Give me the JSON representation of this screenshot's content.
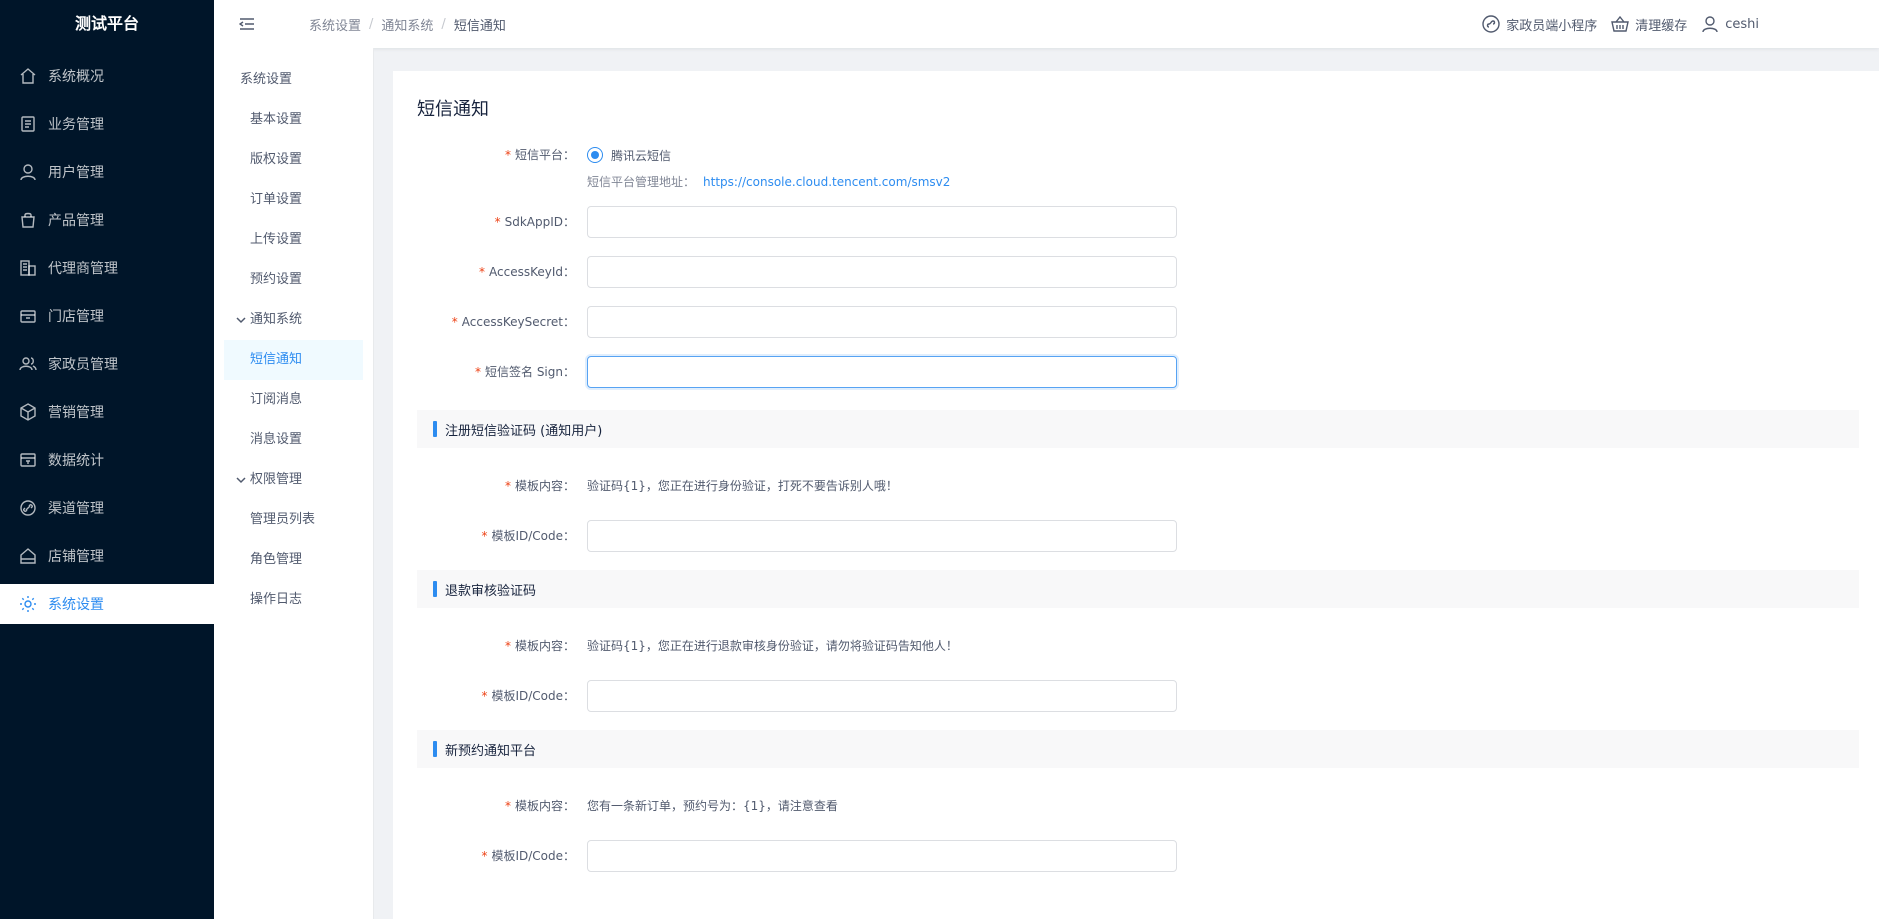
{
  "app": {
    "title": "测试平台"
  },
  "sidebar": {
    "items": [
      {
        "label": "系统概况",
        "icon": "home-icon"
      },
      {
        "label": "业务管理",
        "icon": "list-icon"
      },
      {
        "label": "用户管理",
        "icon": "user-icon"
      },
      {
        "label": "产品管理",
        "icon": "bag-icon"
      },
      {
        "label": "代理商管理",
        "icon": "building-icon"
      },
      {
        "label": "门店管理",
        "icon": "store-icon"
      },
      {
        "label": "家政员管理",
        "icon": "people-icon"
      },
      {
        "label": "营销管理",
        "icon": "cube-icon"
      },
      {
        "label": "数据统计",
        "icon": "chart-icon"
      },
      {
        "label": "渠道管理",
        "icon": "link-icon"
      },
      {
        "label": "店铺管理",
        "icon": "shop-icon"
      },
      {
        "label": "系统设置",
        "icon": "gear-icon",
        "active": true
      }
    ]
  },
  "header": {
    "breadcrumb": [
      "系统设置",
      "通知系统",
      "短信通知"
    ],
    "miniapp_label": "家政员端小程序",
    "clear_cache_label": "清理缓存",
    "username": "ceshi"
  },
  "submenu": {
    "title": "系统设置",
    "items_top": [
      "基本设置",
      "版权设置",
      "订单设置",
      "上传设置",
      "预约设置"
    ],
    "group_notify": "通知系统",
    "notify_items": [
      "短信通知",
      "订阅消息",
      "消息设置"
    ],
    "group_perm": "权限管理",
    "perm_items": [
      "管理员列表",
      "角色管理",
      "操作日志"
    ]
  },
  "form": {
    "page_title": "短信通知",
    "platform_label": "短信平台：",
    "platform_option": "腾讯云短信",
    "platform_help": "短信平台管理地址：",
    "platform_url": "https://console.cloud.tencent.com/smsv2",
    "sdk_label": "SdkAppID：",
    "sdk_value": "",
    "keyid_label": "AccessKeyId：",
    "keyid_value": "",
    "secret_label": "AccessKeySecret：",
    "secret_value": "",
    "sign_label": "短信签名 Sign：",
    "sign_value": "",
    "template_label": "模板内容：",
    "code_label": "模板ID/Code：",
    "sections": [
      {
        "title": "注册短信验证码 (通知用户)",
        "template": "验证码{1}，您正在进行身份验证，打死不要告诉别人哦！",
        "code": ""
      },
      {
        "title": "退款审核验证码",
        "template": "验证码{1}，您正在进行退款审核身份验证，请勿将验证码告知他人！",
        "code": ""
      },
      {
        "title": "新预约通知平台",
        "template": "您有一条新订单，预约号为：{1}，请注意查看",
        "code": ""
      }
    ]
  }
}
